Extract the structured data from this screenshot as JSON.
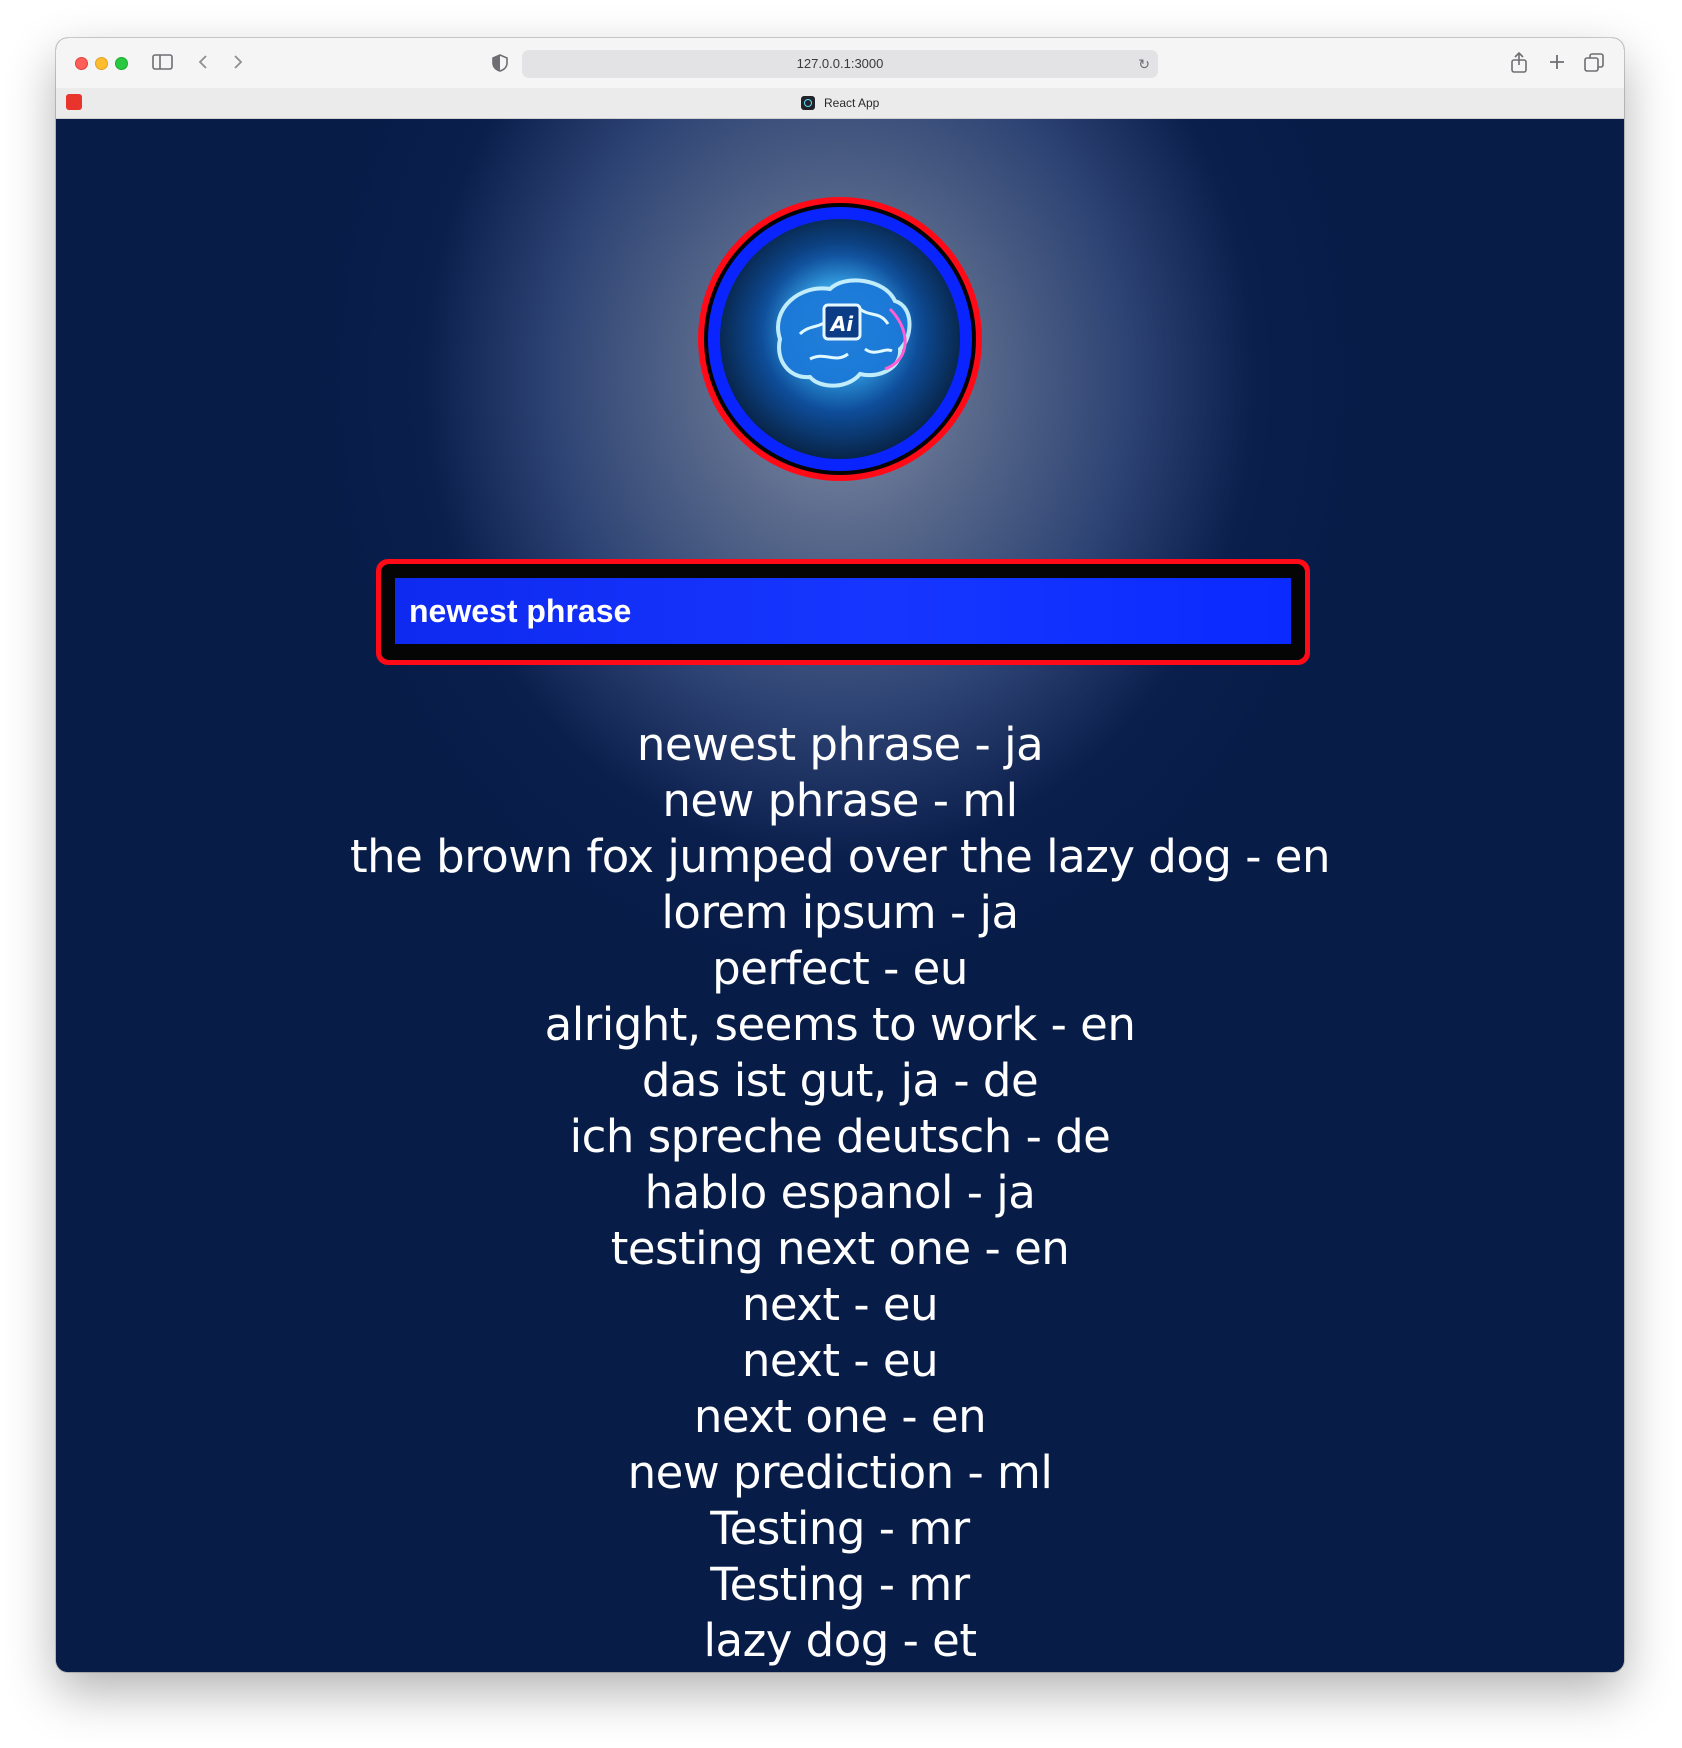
{
  "browser": {
    "url": "127.0.0.1:3000",
    "tab_title": "React App"
  },
  "app": {
    "logo_text": "Ai",
    "input_value": "newest phrase"
  },
  "phrases": [
    "newest phrase - ja",
    "new phrase - ml",
    "the brown fox jumped over the lazy dog - en",
    "lorem ipsum - ja",
    "perfect - eu",
    "alright, seems to work - en",
    "das ist gut, ja - de",
    "ich spreche deutsch - de",
    "hablo espanol - ja",
    "testing next one - en",
    "next - eu",
    "next - eu",
    "next one - en",
    "new prediction - ml",
    "Testing - mr",
    "Testing - mr",
    "lazy dog - et"
  ],
  "colors": {
    "background": "#081c48",
    "input_border": "#ff0a16",
    "input_fill": "#1636ff"
  }
}
